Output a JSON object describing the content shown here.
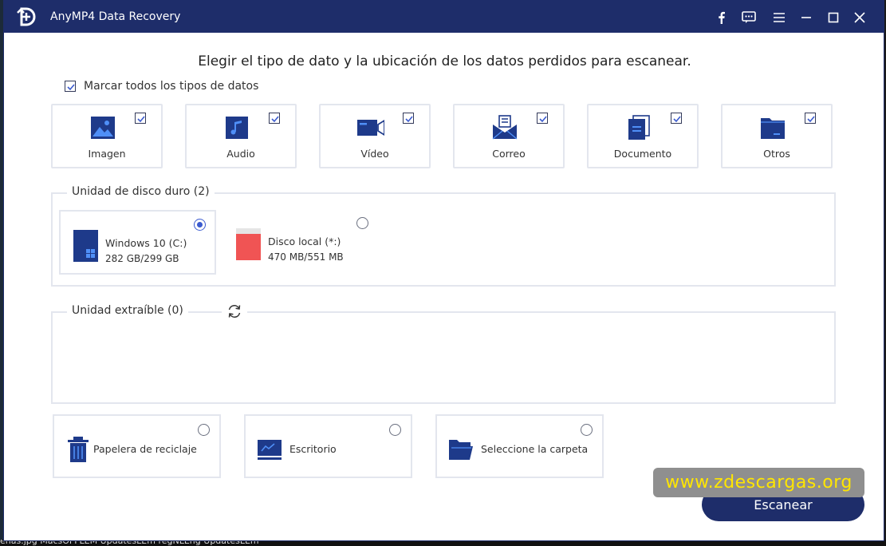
{
  "window": {
    "title": "AnyMP4 Data Recovery"
  },
  "titlebar_buttons": [
    "facebook-icon",
    "feedback-icon",
    "menu-icon",
    "minimize-icon",
    "maximize-icon",
    "close-icon"
  ],
  "headline": "Elegir el tipo de dato y la ubicación de los datos perdidos para escanear.",
  "check_all": {
    "label": "Marcar todos los tipos de datos",
    "checked": true
  },
  "data_types": [
    {
      "label": "Imagen",
      "icon": "image-icon",
      "checked": true
    },
    {
      "label": "Audio",
      "icon": "audio-icon",
      "checked": true
    },
    {
      "label": "Vídeo",
      "icon": "video-icon",
      "checked": true
    },
    {
      "label": "Correo",
      "icon": "mail-icon",
      "checked": true
    },
    {
      "label": "Documento",
      "icon": "document-icon",
      "checked": true
    },
    {
      "label": "Otros",
      "icon": "folder-other-icon",
      "checked": true
    }
  ],
  "hard_drives": {
    "title": "Unidad de disco duro (2)",
    "drives": [
      {
        "name": "Windows 10 (C:)",
        "size": "282 GB/299 GB",
        "selected": true
      },
      {
        "name": "Disco local (*:)",
        "size": "470 MB/551 MB",
        "selected": false
      }
    ]
  },
  "removable": {
    "title": "Unidad extraíble (0)",
    "refresh_icon": "refresh-icon"
  },
  "locations": [
    {
      "label": "Papelera de reciclaje",
      "icon": "trash-icon",
      "selected": false
    },
    {
      "label": "Escritorio",
      "icon": "desktop-icon",
      "selected": false
    },
    {
      "label": "Seleccione la carpeta",
      "icon": "folder-open-icon",
      "selected": false
    }
  ],
  "watermark": "www.zdescargas.org",
  "scan_button": "Escanear",
  "taskbar_text": "enas.jpg   MacsOFFLEM   UpdatesLEm   regNLEng   UpdatesLEm",
  "colors": {
    "titlebar": "#1e2d6a",
    "accent": "#3b5bcf",
    "icon_blue": "#1e3a8a",
    "disk_red": "#f05454",
    "watermark_text": "#ffe600"
  }
}
